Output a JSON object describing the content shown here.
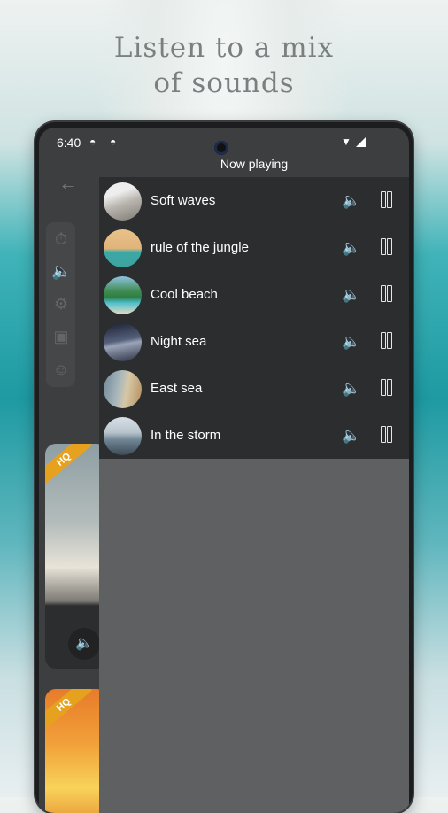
{
  "headline": {
    "line1": "Listen to a mix",
    "line2": "of sounds"
  },
  "status": {
    "time": "6:40"
  },
  "now_playing": {
    "title": "Now playing"
  },
  "sounds": [
    {
      "label": "Soft waves",
      "color": "#c9c6c2"
    },
    {
      "label": "rule of the jungle",
      "color": "#d8b27c"
    },
    {
      "label": "Cool beach",
      "color": "#5aa7b8"
    },
    {
      "label": "Night sea",
      "color": "#3d4a63"
    },
    {
      "label": "East sea",
      "color": "#8a9aa2"
    },
    {
      "label": "In the storm",
      "color": "#9aa5ad"
    }
  ],
  "background_cards": {
    "badge": "HQ"
  },
  "icons": {
    "back": "arrow-left-icon",
    "timer": "timer-icon",
    "volume": "volume-icon",
    "settings": "settings-icon",
    "store": "store-icon",
    "chat": "chat-icon",
    "pause": "pause-icon"
  }
}
